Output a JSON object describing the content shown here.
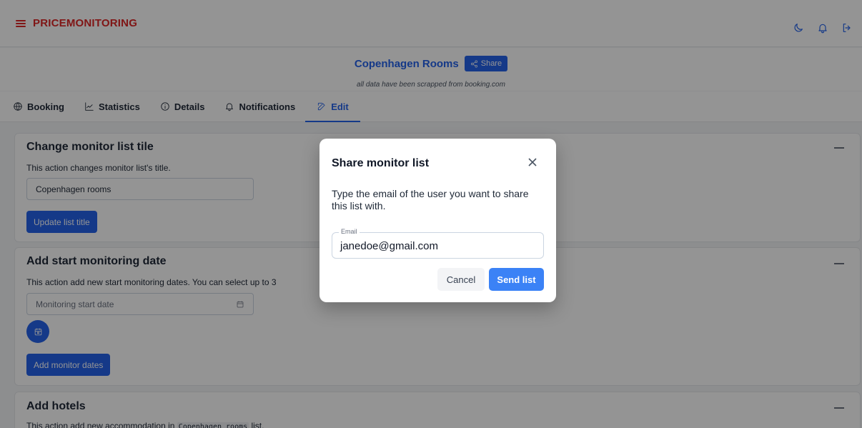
{
  "header": {
    "brand": "PRICEMONITORING",
    "icons": [
      "menu-icon",
      "moon-icon",
      "bell-icon",
      "logout-icon"
    ]
  },
  "titlebar": {
    "list_title": "Copenhagen Rooms",
    "share_label": "Share",
    "subtitle": "all data have been scrapped from booking.com"
  },
  "tabs": [
    {
      "label": "Booking",
      "icon": "globe-icon"
    },
    {
      "label": "Statistics",
      "icon": "chart-icon"
    },
    {
      "label": "Details",
      "icon": "info-icon"
    },
    {
      "label": "Notifications",
      "icon": "bell-icon"
    },
    {
      "label": "Edit",
      "icon": "edit-icon",
      "active": true
    }
  ],
  "cards": {
    "title_card": {
      "title": "Change monitor list tile",
      "desc": "This action changes monitor list's title.",
      "input_value": "Copenhagen rooms",
      "button": "Update list title"
    },
    "dates_card": {
      "title": "Add start monitoring date",
      "desc": "This action add new start monitoring dates. You can select up to 3",
      "placeholder": "Monitoring start date",
      "button": "Add monitor dates"
    },
    "hotels_card": {
      "title": "Add hotels",
      "desc_prefix": "This action add new accommodation in",
      "desc_code": "Copenhagen rooms",
      "desc_suffix": "list."
    }
  },
  "modal": {
    "title": "Share monitor list",
    "text": "Type the email of the user you want to share this list with.",
    "email_label": "Email",
    "email_value": "janedoe@gmail.com",
    "cancel_label": "Cancel",
    "send_label": "Send list"
  },
  "colors": {
    "brand": "#dc2626",
    "primary": "#2563eb",
    "send_button": "#3b82f6"
  }
}
